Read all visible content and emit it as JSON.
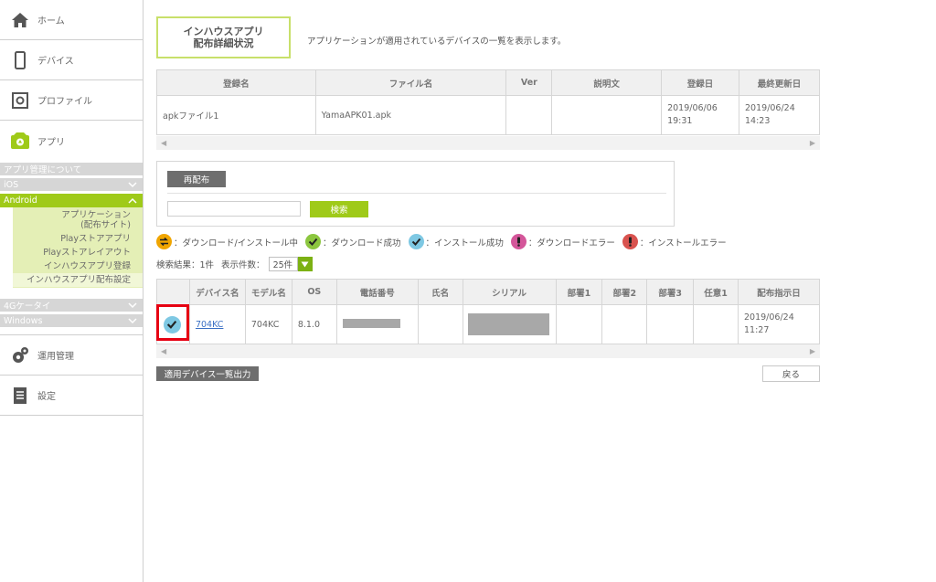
{
  "sidebar": {
    "home": "ホーム",
    "devices": "デバイス",
    "profiles": "プロファイル",
    "apps": "アプリ",
    "app_manage_about": "アプリ管理について",
    "ios": "iOS",
    "android": "Android",
    "android_items": [
      "アプリケーション\n(配布サイト)",
      "Playストアアプリ",
      "Playストアレイアウト",
      "インハウスアプリ登録",
      "インハウスアプリ配布設定"
    ],
    "4g": "4Gケータイ",
    "windows": "Windows",
    "ops": "運用管理",
    "settings": "設定"
  },
  "title": {
    "line1": "インハウスアプリ",
    "line2": "配布詳細状況",
    "desc": "アプリケーションが適用されているデバイスの一覧を表示します。"
  },
  "app_table": {
    "headers": [
      "登録名",
      "ファイル名",
      "Ver",
      "説明文",
      "登録日",
      "最終更新日"
    ],
    "row": {
      "name": "apkファイル1",
      "file": "YamaAPK01.apk",
      "ver": "",
      "desc": "",
      "registered": "2019/06/06 19:31",
      "updated": "2019/06/24 14:23"
    }
  },
  "scroll": {
    "left": "◀",
    "right": "▶"
  },
  "redistribute": {
    "button": "再配布",
    "search_button": "検索",
    "search_value": ""
  },
  "legend": [
    {
      "icon": "arrows-icon",
      "color": "#f0a500",
      "label": "：ダウンロード/インストール中"
    },
    {
      "icon": "check-icon",
      "color": "#8cc63f",
      "label": "：ダウンロード成功"
    },
    {
      "icon": "check-icon",
      "color": "#7ec8e3",
      "label": "：インストール成功"
    },
    {
      "icon": "exclamation-icon",
      "color": "#d4569a",
      "label": "：ダウンロードエラー"
    },
    {
      "icon": "exclamation-icon",
      "color": "#d9534f",
      "label": "：インストールエラー"
    }
  ],
  "results": {
    "count_label": "検索結果：1件",
    "per_page_label": "表示件数：",
    "per_page_value": "25件"
  },
  "device_table": {
    "headers": [
      "",
      "デバイス名",
      "モデル名",
      "OS",
      "電話番号",
      "氏名",
      "シリアル",
      "部署1",
      "部署2",
      "部署3",
      "任意1",
      "配布指示日"
    ],
    "row": {
      "device": "704KC",
      "model": "704KC",
      "os": "8.1.0",
      "date": "2019/06/24 11:27"
    }
  },
  "buttons": {
    "export": "適用デバイス一覧出力",
    "back": "戻る"
  },
  "colors": {
    "accent": "#9fca19",
    "highlight": "#e60012"
  }
}
